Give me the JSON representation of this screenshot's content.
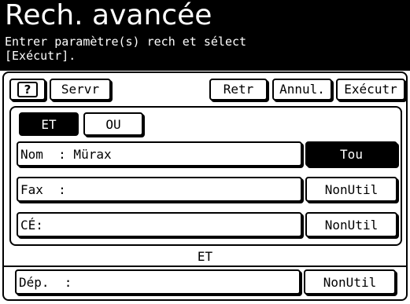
{
  "header": {
    "title": "Rech. avancée",
    "instruction_line1": "Entrer paramètre(s) rech et sélect",
    "instruction_line2": "[Exécutr]."
  },
  "toolbar": {
    "help_label": "?",
    "servr_label": "Servr",
    "retr_label": "Retr",
    "annul_label": "Annul.",
    "exec_label": "Exécutr"
  },
  "logic": {
    "et_label": "ET",
    "ou_label": "OU",
    "selected": "ET"
  },
  "fields": [
    {
      "label": "Nom  : Mürax",
      "option": "Tou"
    },
    {
      "label": "Fax  :",
      "option": "NonUtil"
    },
    {
      "label": "CÉ:",
      "option": "NonUtil"
    }
  ],
  "separator_label": "ET",
  "dept": {
    "label": "Dép.  :",
    "option": "NonUtil"
  }
}
